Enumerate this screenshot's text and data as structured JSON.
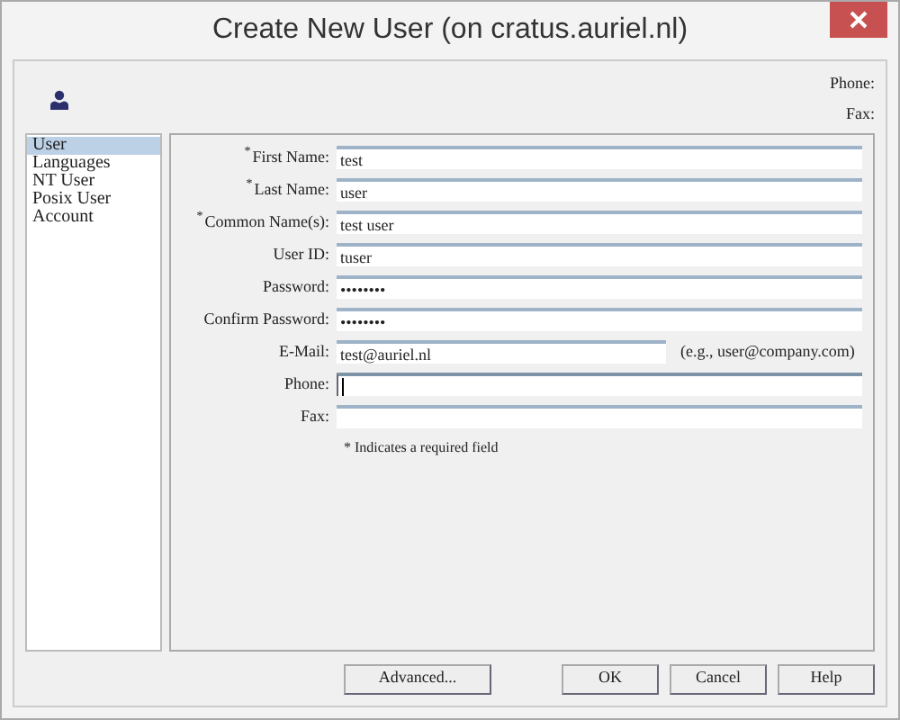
{
  "window": {
    "title": "Create New User (on cratus.auriel.nl)"
  },
  "header": {
    "labels": [
      "Phone:",
      "Fax:"
    ]
  },
  "sidebar": {
    "items": [
      {
        "label": "User",
        "selected": true
      },
      {
        "label": "Languages",
        "selected": false
      },
      {
        "label": "NT User",
        "selected": false
      },
      {
        "label": "Posix User",
        "selected": false
      },
      {
        "label": "Account",
        "selected": false
      }
    ]
  },
  "form": {
    "fields": [
      {
        "marker": "*",
        "label": "First Name:",
        "value": "test",
        "focused": false
      },
      {
        "marker": "*",
        "label": "Last Name:",
        "value": "user",
        "focused": false
      },
      {
        "marker": "*",
        "label": "Common Name(s):",
        "value": "test user",
        "focused": false
      },
      {
        "label": "User ID:",
        "value": "tuser",
        "focused": false
      },
      {
        "label": "Password:",
        "value": "••••••••",
        "focused": false
      },
      {
        "label": "Confirm Password:",
        "value": "••••••••",
        "focused": false
      },
      {
        "label": "E-Mail:",
        "value": "test@auriel.nl",
        "hint": "(e.g., user@company.com)",
        "focused": false
      },
      {
        "label": "Phone:",
        "focused": true
      },
      {
        "label": "Fax:",
        "focused": false
      }
    ],
    "note": "* Indicates a required field"
  },
  "buttons": [
    {
      "label": "Advanced..."
    },
    {
      "label": "OK"
    },
    {
      "label": "Cancel"
    },
    {
      "label": "Help"
    }
  ]
}
